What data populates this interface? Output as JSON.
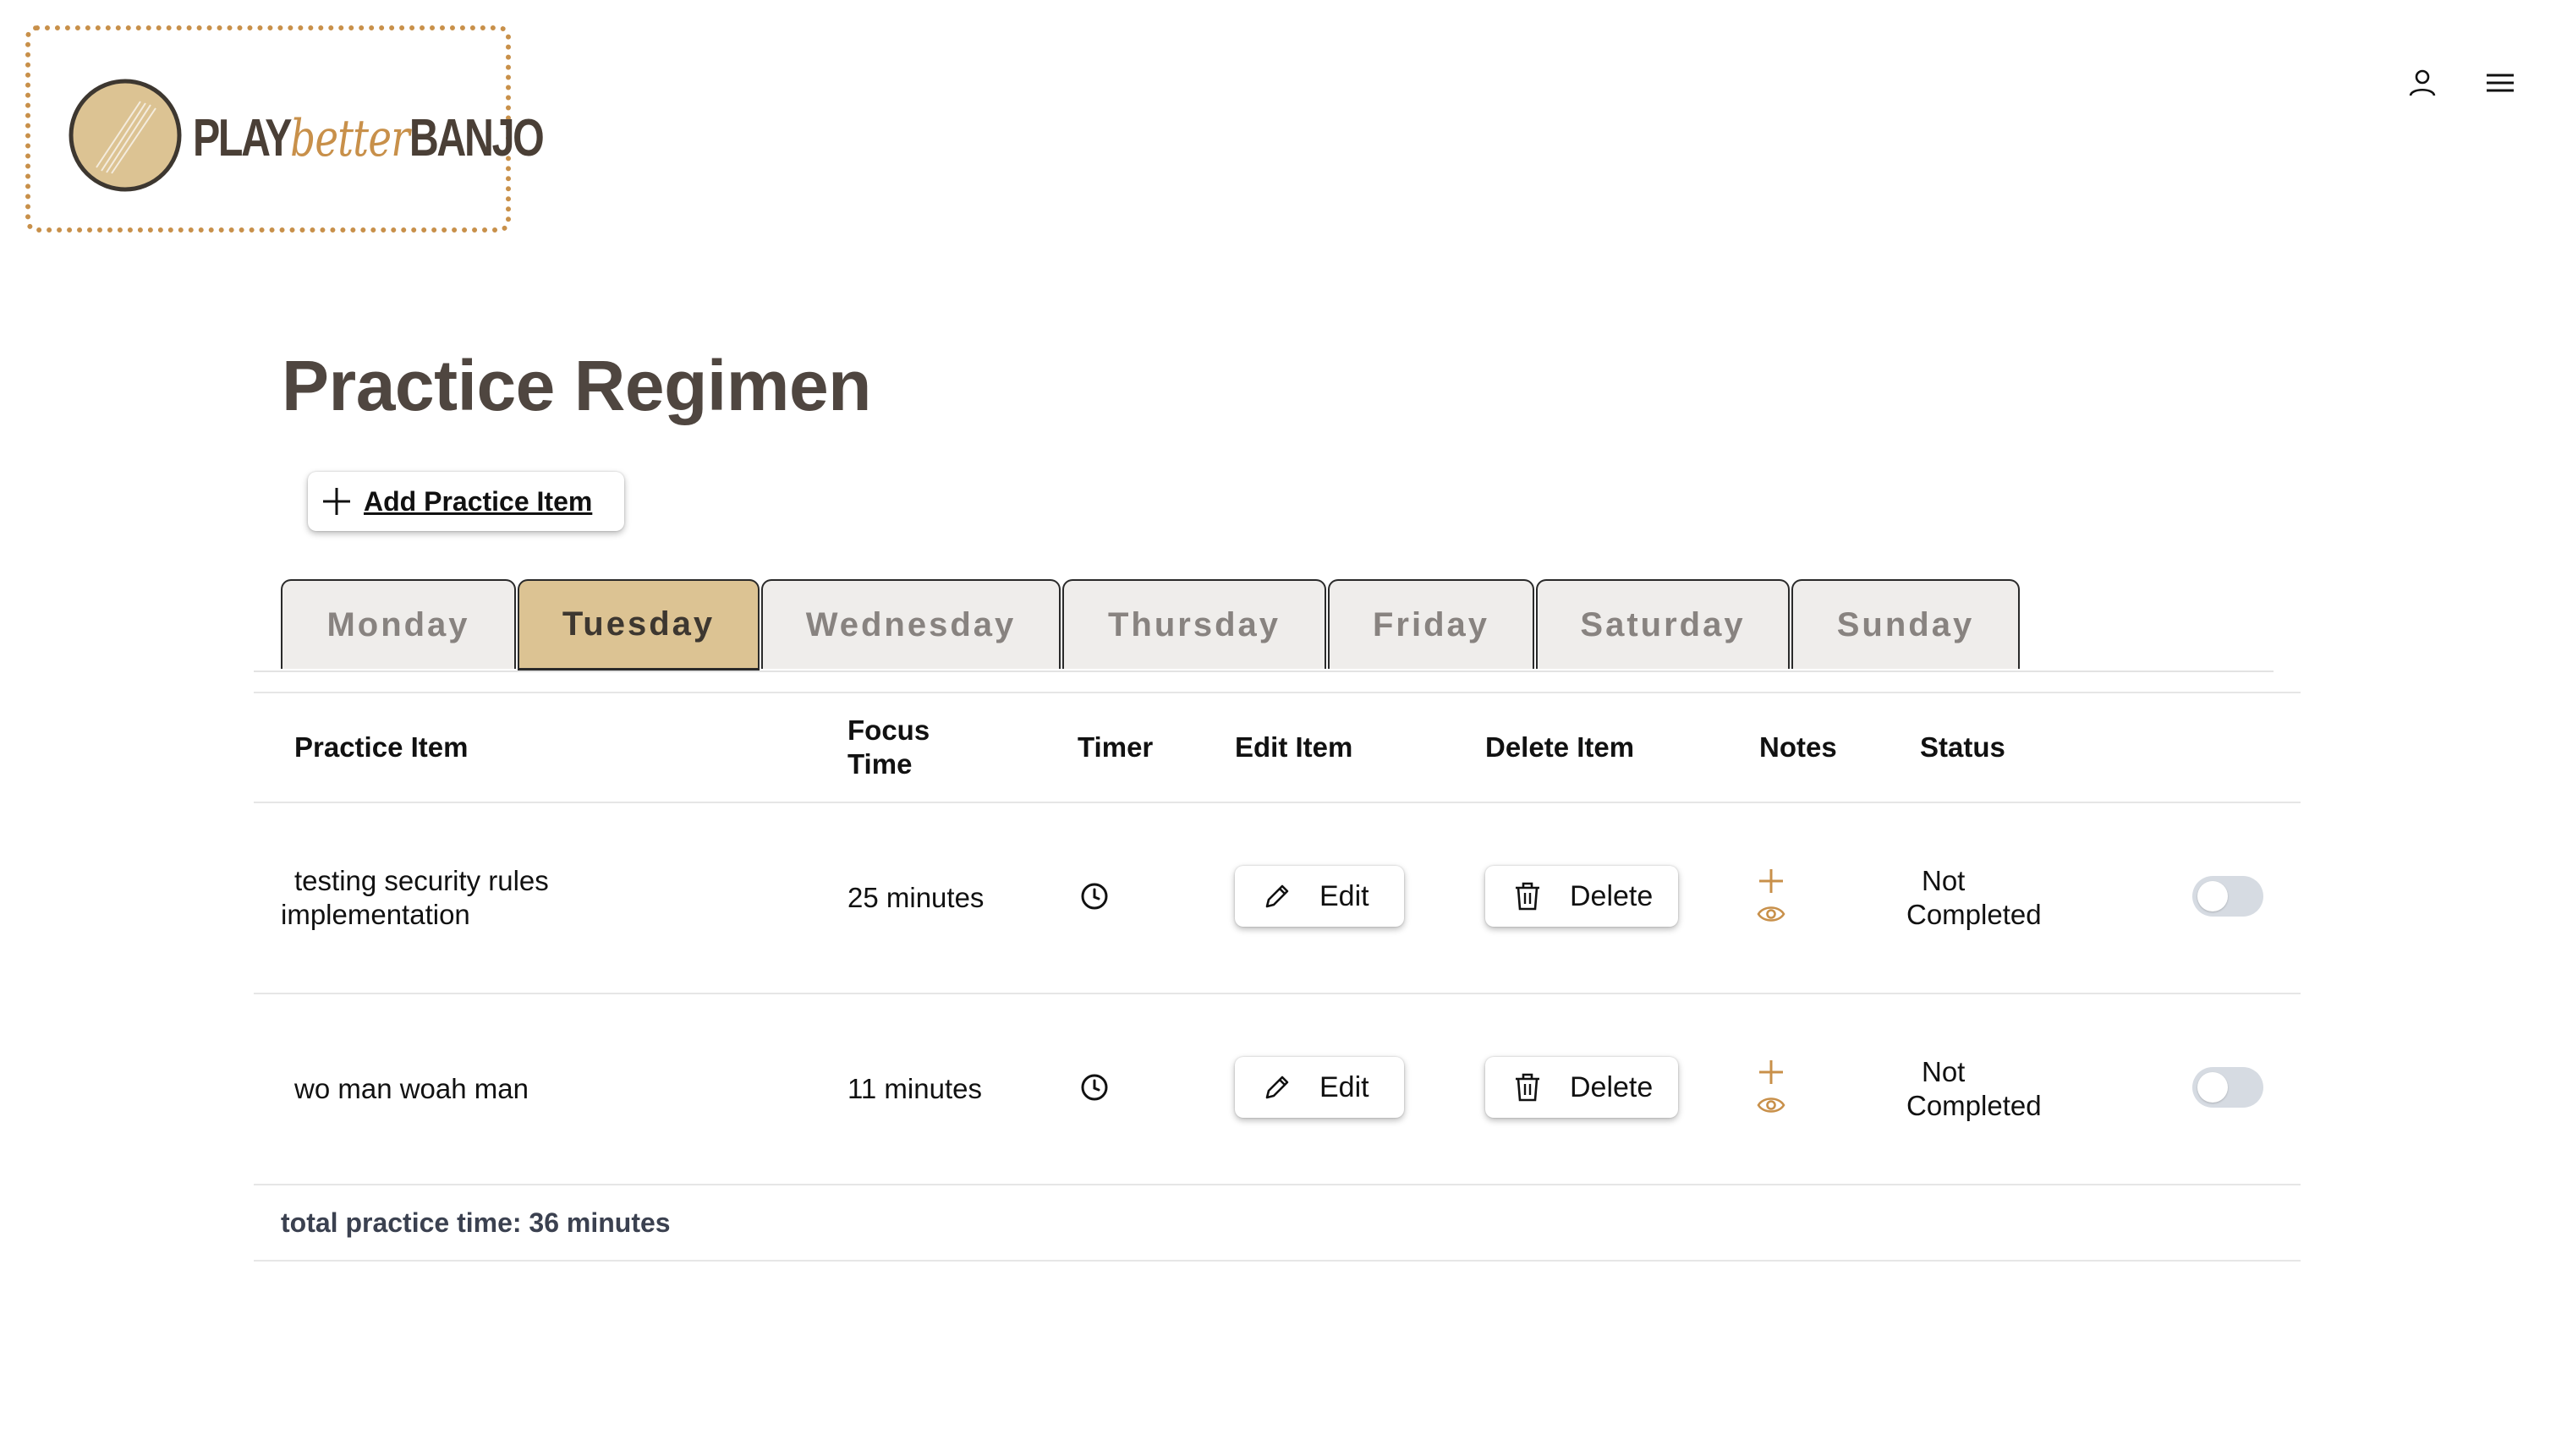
{
  "brand": {
    "logo_word_1": "PLAY",
    "logo_word_2": "better",
    "logo_word_3": "BANJO",
    "accent_color": "#c8904a",
    "logo_fill_color": "#dcc393"
  },
  "header": {
    "icons": [
      "user-icon",
      "hamburger-menu-icon"
    ]
  },
  "page": {
    "title": "Practice Regimen",
    "add_button_label": "Add Practice Item"
  },
  "tabs": [
    {
      "label": "Monday",
      "active": false
    },
    {
      "label": "Tuesday",
      "active": true
    },
    {
      "label": "Wednesday",
      "active": false
    },
    {
      "label": "Thursday",
      "active": false
    },
    {
      "label": "Friday",
      "active": false
    },
    {
      "label": "Saturday",
      "active": false
    },
    {
      "label": "Sunday",
      "active": false
    }
  ],
  "table": {
    "headers": {
      "practice_item": "Practice Item",
      "focus_time_line1": "Focus",
      "focus_time_line2": "Time",
      "timer": "Timer",
      "edit_item": "Edit Item",
      "delete_item": "Delete Item",
      "notes": "Notes",
      "status": "Status"
    },
    "rows": [
      {
        "item_line1": "testing security rules",
        "item_line2": "implementation",
        "focus_time": "25 minutes",
        "edit_label": "Edit",
        "delete_label": "Delete",
        "status_line1": "Not",
        "status_line2": "Completed",
        "completed": false
      },
      {
        "item_line1": "wo man woah man",
        "item_line2": "",
        "focus_time": "11 minutes",
        "edit_label": "Edit",
        "delete_label": "Delete",
        "status_line1": "Not",
        "status_line2": "Completed",
        "completed": false
      }
    ],
    "total_label": "total practice time: 36 minutes"
  }
}
